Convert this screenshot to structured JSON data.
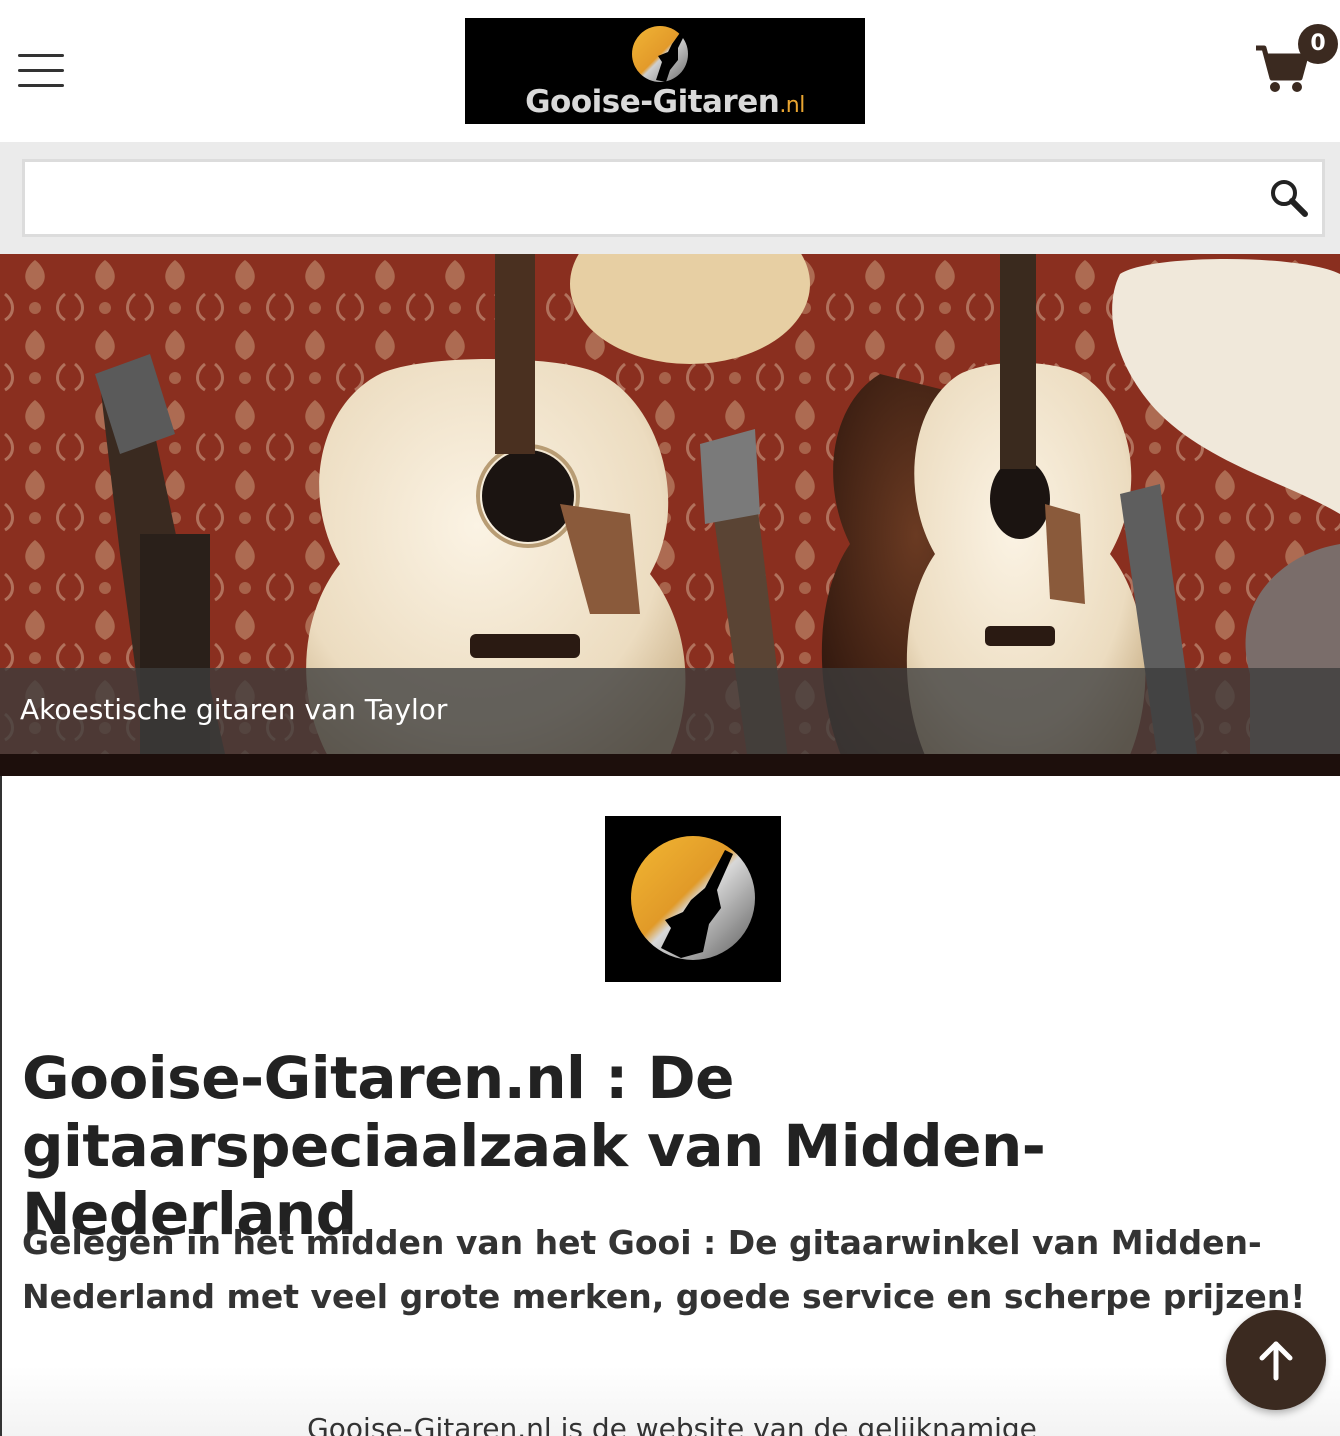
{
  "header": {
    "logo_text": "Gooise-Gitaren",
    "logo_tld": ".nl",
    "cart_count": "0"
  },
  "search": {
    "value": "",
    "placeholder": ""
  },
  "hero": {
    "caption": "Akoestische gitaren van Taylor"
  },
  "main": {
    "title": "Gooise-Gitaren.nl : De gitaarspeciaalzaak van Midden-Nederland",
    "subtitle": "Gelegen in het midden van het Gooi : De gitaarwinkel van Midden-Nederland met veel grote merken, goede service en scherpe prijzen!",
    "partial_text": "Gooise-Gitaren.nl is de website van de gelijknamige"
  },
  "colors": {
    "accent": "#3b2a20",
    "logo_orange": "#e9a531",
    "hero_wall": "#7e2a1b"
  },
  "icons": {
    "menu": "hamburger-icon",
    "cart": "cart-icon",
    "search": "search-icon",
    "back_to_top": "arrow-up-icon"
  }
}
